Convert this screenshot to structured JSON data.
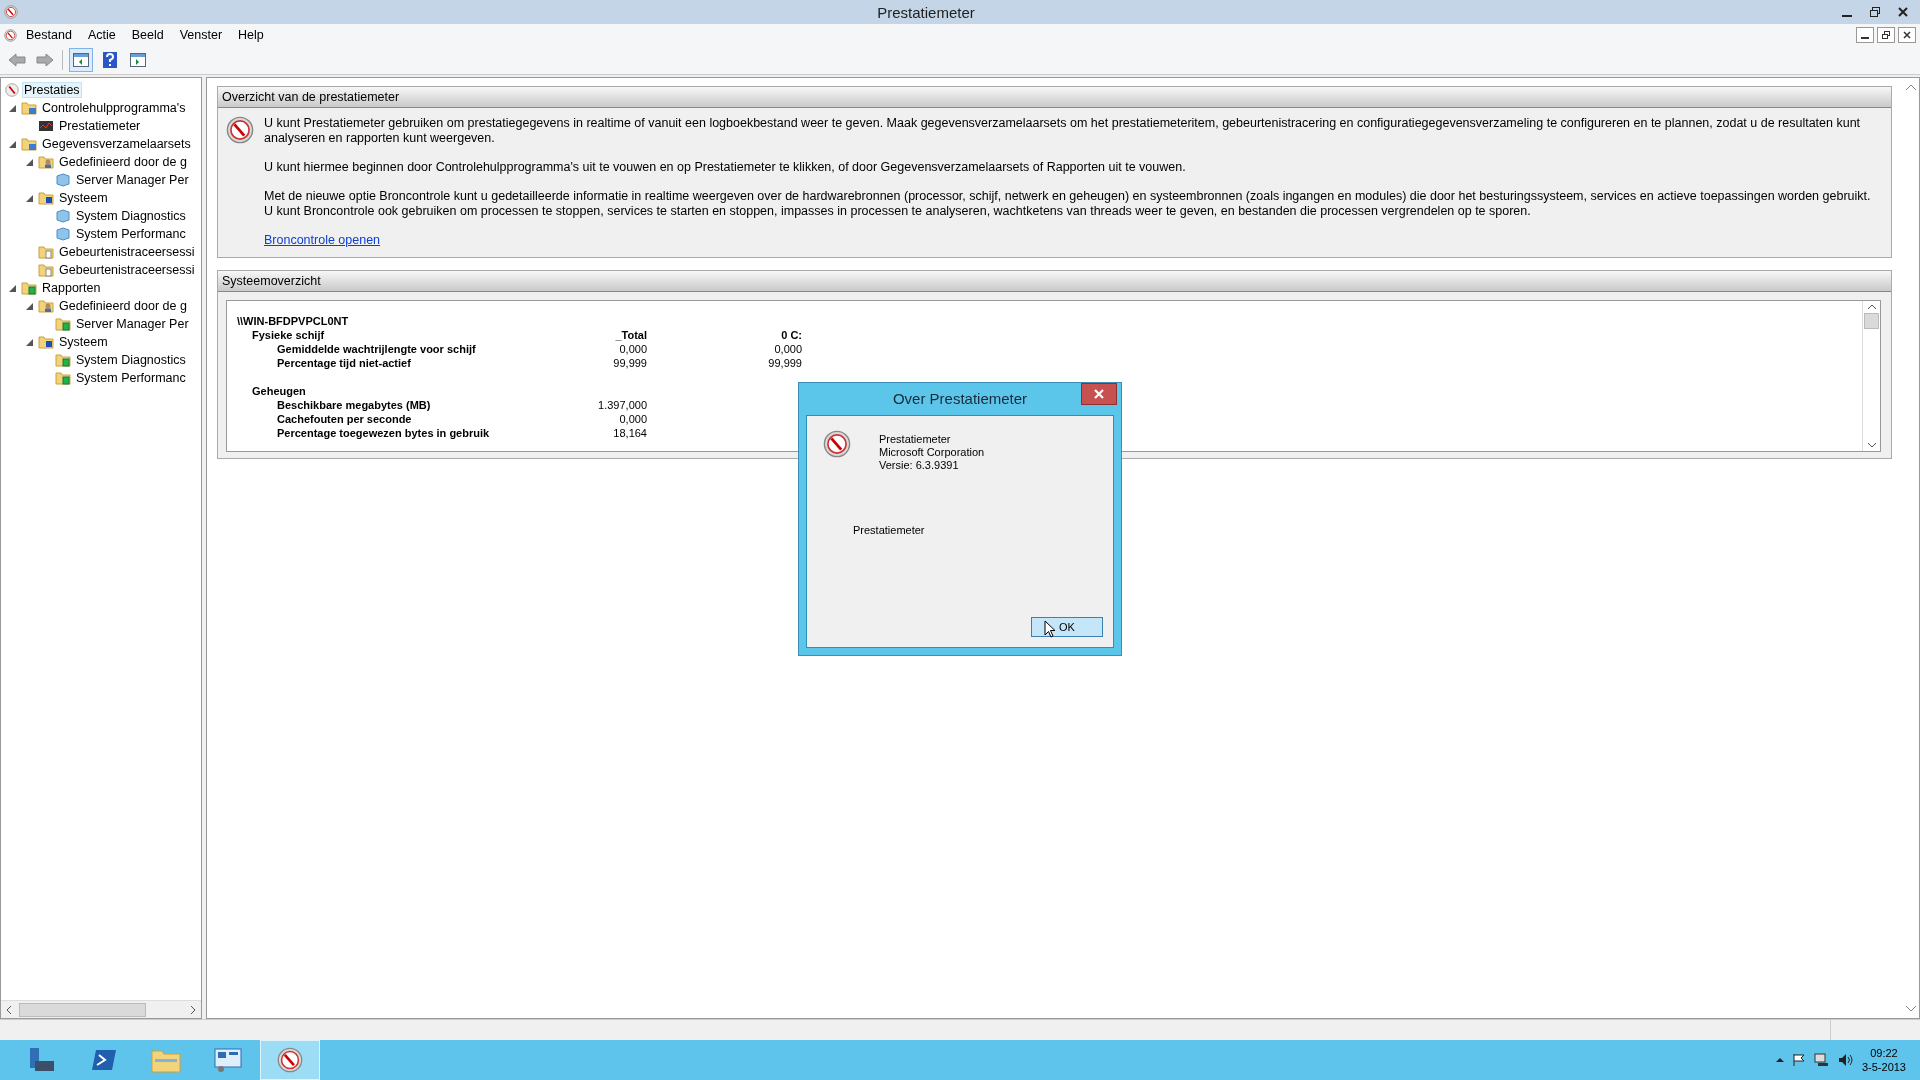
{
  "window": {
    "title": "Prestatiemeter"
  },
  "menu": [
    "Bestand",
    "Actie",
    "Beeld",
    "Venster",
    "Help"
  ],
  "tree": [
    {
      "label": "Prestaties",
      "kind": "app",
      "selected": true,
      "children": [
        {
          "label": "Controlehulpprogramma's",
          "kind": "folder",
          "selected": false,
          "expanded": true,
          "children": [
            {
              "label": "Prestatiemeter",
              "kind": "monitor",
              "selected": false
            }
          ]
        },
        {
          "label": "Gegevensverzamelaarsets",
          "kind": "folder",
          "selected": false,
          "expanded": true,
          "children": [
            {
              "label": "Gedefinieerd door de g",
              "kind": "user",
              "selected": false,
              "expanded": true,
              "children": [
                {
                  "label": "Server Manager Per",
                  "kind": "dataset",
                  "selected": false
                }
              ]
            },
            {
              "label": "Systeem",
              "kind": "system",
              "selected": false,
              "expanded": true,
              "children": [
                {
                  "label": "System Diagnostics",
                  "kind": "dataset",
                  "selected": false
                },
                {
                  "label": "System Performanc",
                  "kind": "dataset",
                  "selected": false
                }
              ]
            },
            {
              "label": "Gebeurtenistraceersessi",
              "kind": "trace",
              "selected": false
            },
            {
              "label": "Gebeurtenistraceersessi",
              "kind": "trace",
              "selected": false
            }
          ]
        },
        {
          "label": "Rapporten",
          "kind": "report",
          "selected": false,
          "expanded": true,
          "children": [
            {
              "label": "Gedefinieerd door de g",
              "kind": "user",
              "selected": false,
              "expanded": true,
              "children": [
                {
                  "label": "Server Manager Per",
                  "kind": "report",
                  "selected": false
                }
              ]
            },
            {
              "label": "Systeem",
              "kind": "system",
              "selected": false,
              "expanded": true,
              "children": [
                {
                  "label": "System Diagnostics",
                  "kind": "report",
                  "selected": false
                },
                {
                  "label": "System Performanc",
                  "kind": "report",
                  "selected": false
                }
              ]
            }
          ]
        }
      ]
    }
  ],
  "overview": {
    "title": "Overzicht van de prestatiemeter",
    "paragraphs": [
      "U kunt Prestatiemeter gebruiken om prestatiegegevens in realtime of vanuit een logboekbestand weer te geven. Maak gegevensverzamelaarsets om het prestatiemeteritem, gebeurtenistracering en configuratiegegevensverzameling te configureren en te plannen, zodat u de resultaten kunt analyseren en rapporten kunt weergeven.",
      "U kunt hiermee beginnen door Controlehulpprogramma's uit te vouwen en op Prestatiemeter te klikken, of door Gegevensverzamelaarsets of Rapporten uit te vouwen.",
      "Met de nieuwe optie Broncontrole kunt u gedetailleerde informatie in realtime weergeven over de hardwarebronnen (processor, schijf, netwerk en geheugen) en systeembronnen (zoals ingangen en modules) die door het besturingssysteem, services en actieve toepassingen worden gebruikt. U kunt Broncontrole ook gebruiken om processen te stoppen, services te starten en stoppen, impasses in processen te analyseren, wachtketens van threads weer te geven, en bestanden die processen vergrendelen op te sporen."
    ],
    "link": "Broncontrole openen"
  },
  "system_overview": {
    "title": "Systeemoverzicht",
    "machine": "\\\\WIN-BFDPVPCL0NT",
    "groups": [
      {
        "name": "Fysieke schijf",
        "columns": [
          "_Total",
          "0 C:"
        ],
        "counters": [
          {
            "name": "Gemiddelde wachtrijlengte voor schijf",
            "values": [
              "0,000",
              "0,000"
            ]
          },
          {
            "name": "Percentage tijd niet-actief",
            "values": [
              "99,999",
              "99,999"
            ]
          }
        ]
      },
      {
        "name": "Geheugen",
        "counters": [
          {
            "name": "Beschikbare megabytes (MB)",
            "values": [
              "1.397,000"
            ]
          },
          {
            "name": "Cachefouten per seconde",
            "values": [
              "0,000"
            ]
          },
          {
            "name": "Percentage toegewezen bytes in gebruik",
            "values": [
              "18,164"
            ]
          }
        ]
      }
    ]
  },
  "dialog": {
    "title": "Over Prestatiemeter",
    "lines": [
      "Prestatiemeter",
      "Microsoft Corporation",
      "Versie: 6.3.9391"
    ],
    "description": "Prestatiemeter",
    "button": "OK"
  },
  "taskbar": {
    "apps": [
      {
        "kind": "server",
        "selected": false
      },
      {
        "kind": "shell",
        "selected": false
      },
      {
        "kind": "explorer",
        "selected": false
      },
      {
        "kind": "control",
        "selected": false
      },
      {
        "kind": "perfmon",
        "selected": true
      }
    ],
    "time": "09:22",
    "date": "3-5-2013"
  }
}
